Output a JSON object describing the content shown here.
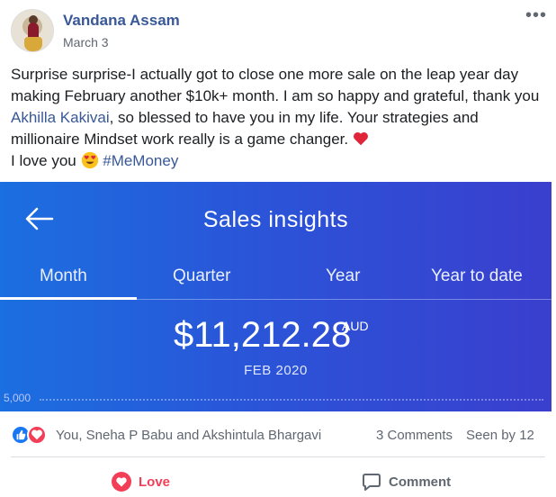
{
  "post": {
    "author": "Vandana Assam",
    "date": "March 3",
    "text_1": "Surprise surprise-I actually got to close one more sale on the leap year day making February another $10k+ month. I am so happy and grateful, thank you ",
    "mention": "Akhilla Kakivai",
    "text_2": ", so blessed to have you in my life. Your strategies and millionaire Mindset work really is a game changer. ",
    "text_3": "I love you ",
    "hashtag": "#MeMoney"
  },
  "insights": {
    "title": "Sales insights",
    "tabs": [
      "Month",
      "Quarter",
      "Year",
      "Year to date"
    ],
    "selected_tab": "Month",
    "amount": "$11,212.28",
    "currency": "AUD",
    "period": "FEB 2020",
    "axis_label": "5,000"
  },
  "reactions": {
    "names": "You, Sneha P Babu and Akshintula Bhargavi",
    "comments": "3 Comments",
    "seen": "Seen by 12",
    "icons": [
      "like-icon",
      "love-icon"
    ]
  },
  "actions": {
    "love_label": "Love",
    "comment_label": "Comment"
  },
  "colors": {
    "link": "#385898",
    "love": "#f33e58",
    "like": "#1877f2",
    "insights_bg_start": "#1b6fe0",
    "insights_bg_end": "#3a3fce"
  }
}
